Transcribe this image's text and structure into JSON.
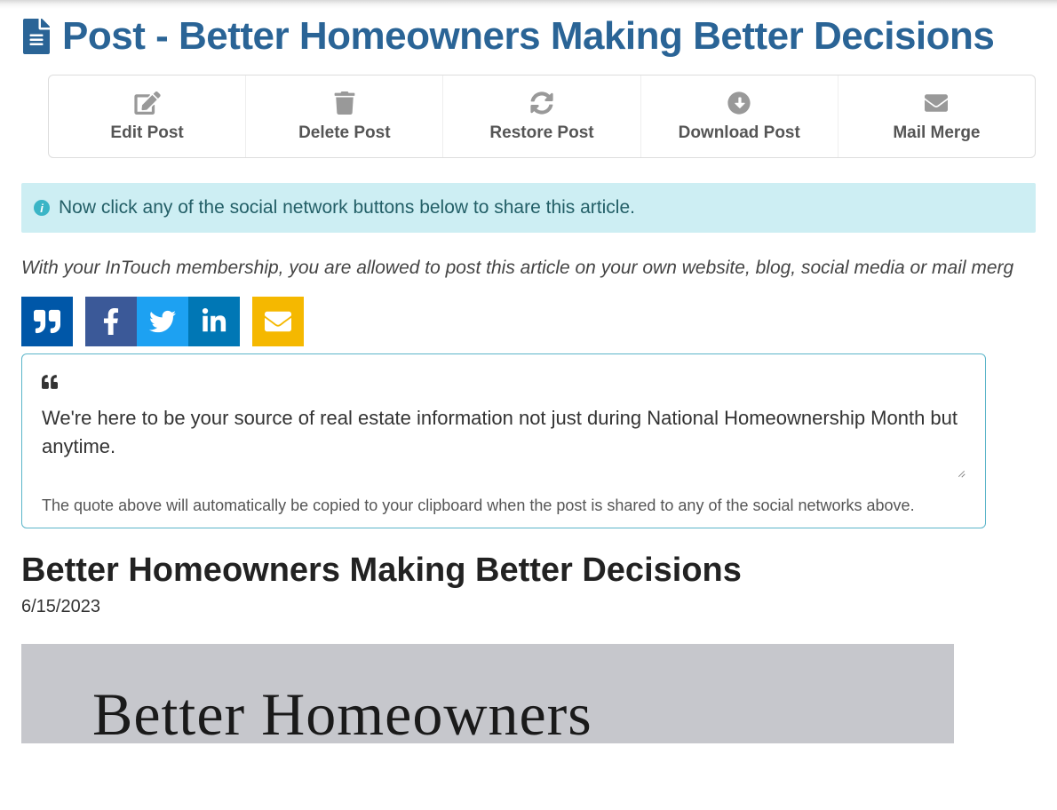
{
  "header": {
    "title_prefix": "Post - ",
    "title": "Better Homeowners Making Better Decisions"
  },
  "toolbar": {
    "edit": "Edit Post",
    "delete": "Delete Post",
    "restore": "Restore Post",
    "download": "Download Post",
    "mailmerge": "Mail Merge"
  },
  "alert": {
    "text": "Now click any of the social network buttons below to share this article."
  },
  "meta": {
    "text": "With your InTouch membership, you are allowed to post this article on your own website, blog, social media or mail merg"
  },
  "share": {
    "icons": {
      "quote": "quote-icon",
      "facebook": "facebook-icon",
      "twitter": "twitter-icon",
      "linkedin": "linkedin-icon",
      "email": "email-icon"
    }
  },
  "quote": {
    "text": "We're here to be your source of real estate information not just during National Homeownership Month but anytime.",
    "note": "The quote above will automatically be copied to your clipboard when the post is shared to any of the social networks above."
  },
  "article": {
    "title": "Better Homeowners Making Better Decisions",
    "date": "6/15/2023",
    "hero_text": "Better Homeowners"
  }
}
